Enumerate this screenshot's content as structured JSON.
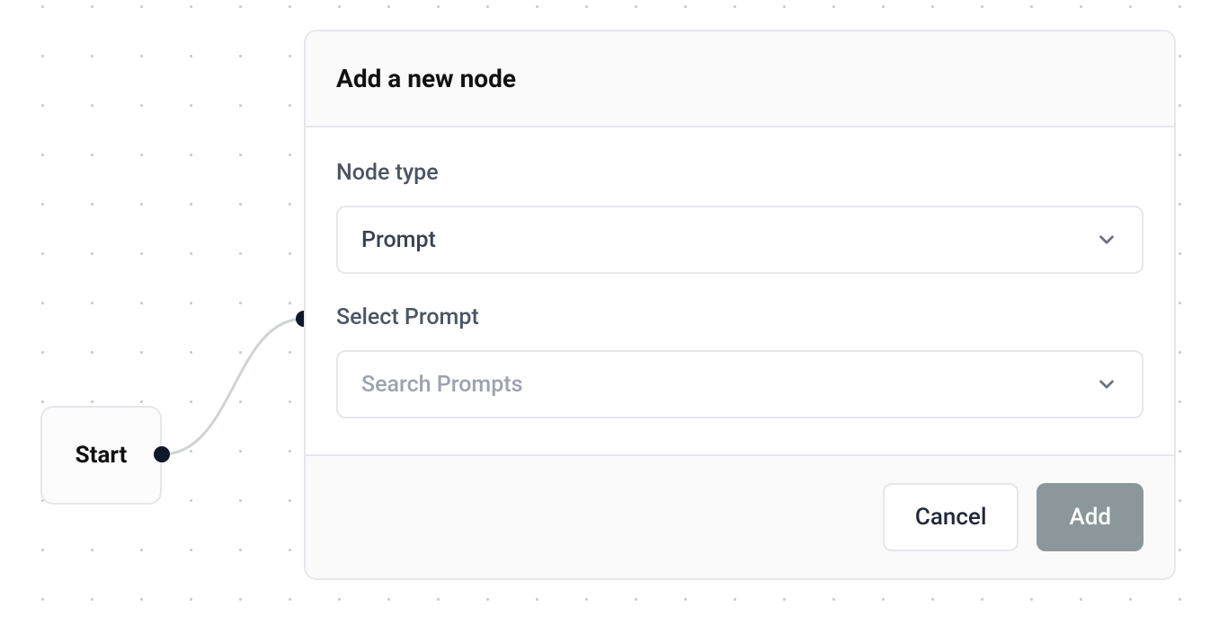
{
  "canvas": {
    "start_node_label": "Start"
  },
  "panel": {
    "title": "Add a new node",
    "fields": {
      "node_type_label": "Node type",
      "node_type_value": "Prompt",
      "select_prompt_label": "Select Prompt",
      "select_prompt_placeholder": "Search Prompts"
    },
    "actions": {
      "cancel": "Cancel",
      "add": "Add"
    }
  }
}
